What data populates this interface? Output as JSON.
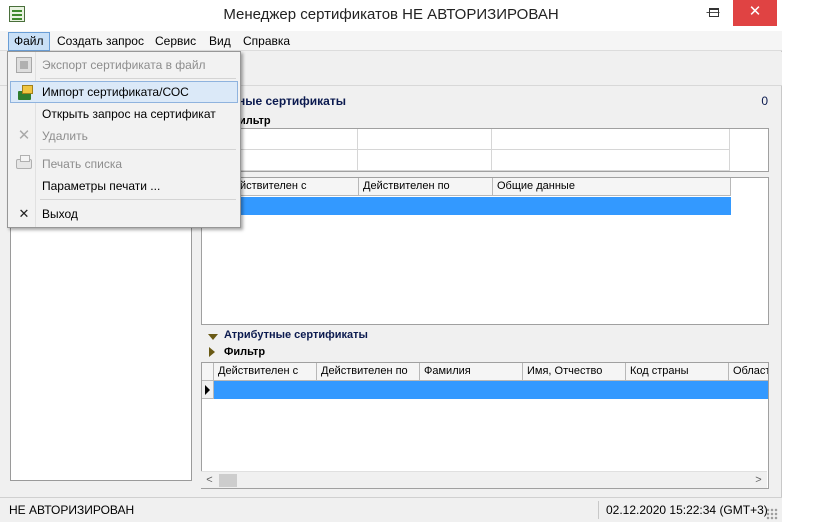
{
  "window": {
    "title": "Менеджер сертификатов   НЕ АВТОРИЗИРОВАН",
    "controls": {
      "minimize": "—",
      "close": "✕"
    }
  },
  "menubar": {
    "items": [
      "Файл",
      "Создать запрос",
      "Сервис",
      "Вид",
      "Справка"
    ]
  },
  "file_menu": {
    "items": [
      {
        "label": "Экспорт сертификата в файл",
        "enabled": false,
        "icon": "export-icon"
      },
      {
        "label": "Импорт сертификата/СОС",
        "enabled": true,
        "icon": "import-icon"
      },
      {
        "label": "Открыть запрос на сертификат",
        "enabled": true,
        "icon": ""
      },
      {
        "label": "Удалить",
        "enabled": false,
        "icon": "delete-icon"
      },
      {
        "label": "Печать списка",
        "enabled": false,
        "icon": "print-icon"
      },
      {
        "label": "Параметры печати ...",
        "enabled": true,
        "icon": ""
      },
      {
        "label": "Выход",
        "enabled": true,
        "icon": "exit-icon"
      }
    ]
  },
  "personal_section": {
    "title_visible_part": "ные сертификаты",
    "count": "0",
    "filter_label_visible_part": "ильтр",
    "columns_visible": [
      "йствителен с",
      "Действителен по",
      "Общие данные"
    ]
  },
  "attribute_section": {
    "title": "Атрибутные сертификаты",
    "filter_label": "Фильтр",
    "columns": [
      "Действителен с",
      "Действителен по",
      "Фамилия",
      "Имя, Отчество",
      "Код страны",
      "Област"
    ]
  },
  "scrollbar": {
    "left_arrow": "<",
    "right_arrow": ">"
  },
  "statusbar": {
    "auth_status": "НЕ АВТОРИЗИРОВАН",
    "datetime": "02.12.2020 15:22:34 (GMT+3)"
  },
  "colors": {
    "selection": "#3399ff",
    "close_button": "#e04343",
    "section_title": "#0b1a4f"
  }
}
